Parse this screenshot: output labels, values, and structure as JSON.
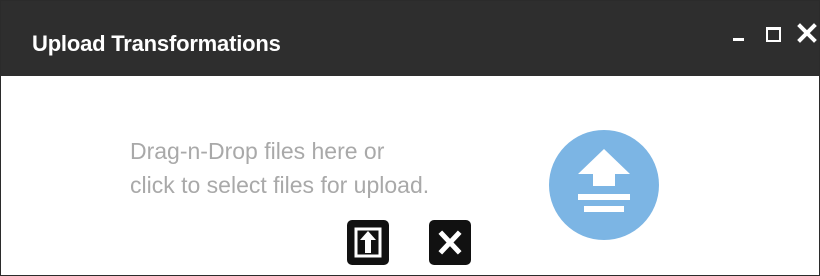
{
  "dialog": {
    "title": "Upload Transformations",
    "controls": {
      "minimize_icon": "minimize-icon",
      "maximize_icon": "maximize-icon",
      "close_icon": "close-icon"
    }
  },
  "dropzone": {
    "line1": "Drag-n-Drop files here or",
    "line2": "click to select files for upload.",
    "icon": "upload-circle-icon"
  },
  "actions": {
    "upload_icon": "upload-icon",
    "clear_icon": "clear-icon"
  },
  "colors": {
    "titlebar_bg": "#2e2e2e",
    "title_text": "#ffffff",
    "hint_text": "#a9a9a9",
    "upload_circle": "#7cb5e4",
    "button_bg": "#111111"
  }
}
